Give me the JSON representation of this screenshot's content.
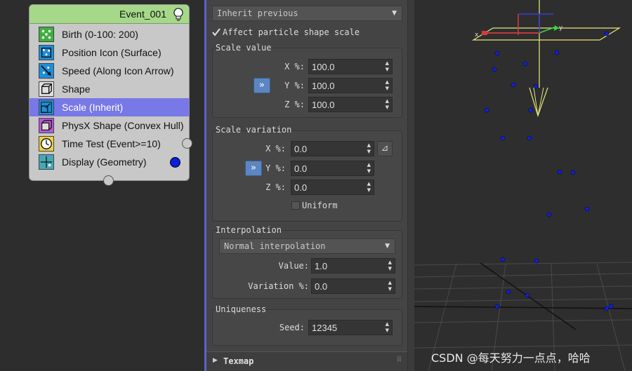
{
  "particle_view": {
    "event": {
      "title": "Event_001",
      "operators": [
        {
          "label": "Birth (0-100: 200)",
          "icon": "birth-icon"
        },
        {
          "label": "Position Icon (Surface)",
          "icon": "position-icon"
        },
        {
          "label": "Speed (Along Icon Arrow)",
          "icon": "speed-icon"
        },
        {
          "label": "Shape",
          "icon": "shape-icon"
        },
        {
          "label": "Scale (Inherit)",
          "icon": "scale-icon",
          "selected": true
        },
        {
          "label": "PhysX Shape (Convex Hull)",
          "icon": "physx-shape-icon"
        },
        {
          "label": "Time Test (Event>=10)",
          "icon": "time-test-icon"
        },
        {
          "label": "Display (Geometry)",
          "icon": "display-icon"
        }
      ]
    }
  },
  "params": {
    "type_dropdown": "Inherit previous",
    "affect_shape_scale": {
      "label": "Affect particle shape scale",
      "checked": true
    },
    "scale_value": {
      "title": "Scale value",
      "x_label": "X %:",
      "x": "100.0",
      "y_label": "Y %:",
      "y": "100.0",
      "z_label": "Z %:",
      "z": "100.0",
      "lock_button": "»"
    },
    "scale_variation": {
      "title": "Scale variation",
      "x_label": "X %:",
      "x": "0.0",
      "y_label": "Y %:",
      "y": "0.0",
      "z_label": "Z %:",
      "z": "0.0",
      "lock_button": "»",
      "uniform": {
        "label": "Uniform",
        "checked": false
      }
    },
    "interpolation": {
      "title": "Interpolation",
      "mode": "Normal interpolation",
      "value_label": "Value:",
      "value": "1.0",
      "variation_label": "Variation %:",
      "variation": "0.0"
    },
    "uniqueness": {
      "title": "Uniqueness",
      "seed_label": "Seed:",
      "seed": "12345"
    },
    "texmap_rollout": "Texmap"
  },
  "viewport": {
    "watermark": "CSDN @每天努力一点点，哈哈"
  },
  "colors": {
    "event_header": "#a6d88a",
    "selected_row": "#7878e6",
    "particle": "#1020e0",
    "lock_button": "#5b86c2"
  }
}
